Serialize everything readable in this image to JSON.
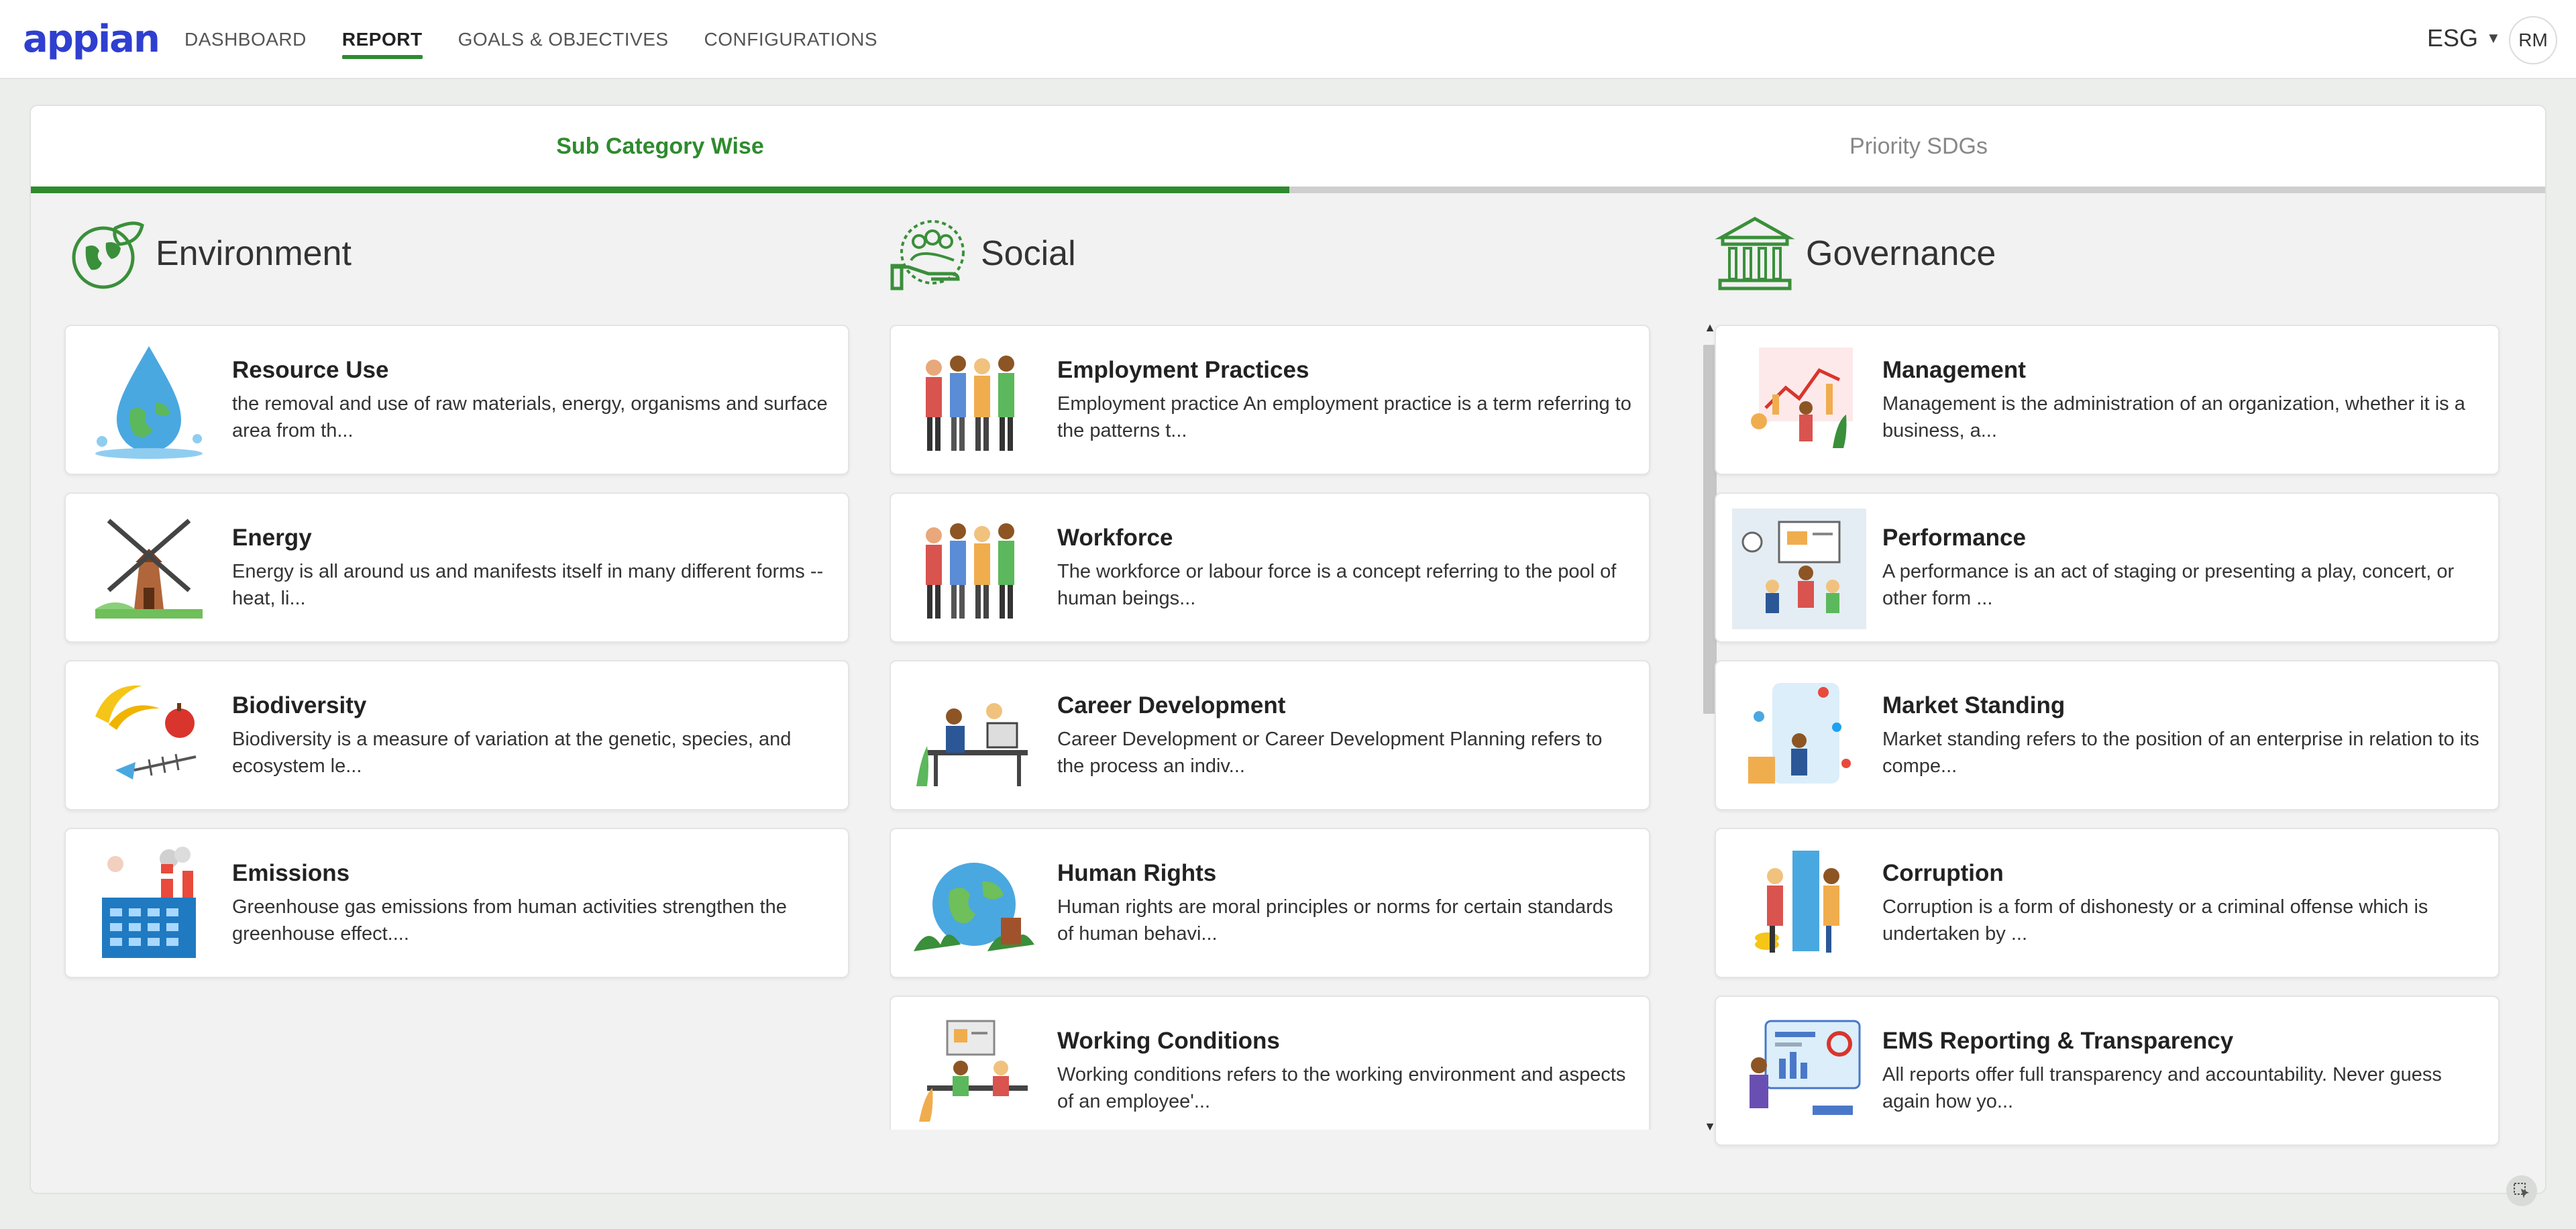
{
  "app": {
    "logo": "appian"
  },
  "nav": {
    "items": [
      {
        "label": "DASHBOARD",
        "active": false
      },
      {
        "label": "REPORT",
        "active": true
      },
      {
        "label": "GOALS & OBJECTIVES",
        "active": false
      },
      {
        "label": "CONFIGURATIONS",
        "active": false
      }
    ],
    "esg_menu": "ESG",
    "avatar_initials": "RM"
  },
  "tabs": [
    {
      "label": "Sub Category Wise",
      "active": true
    },
    {
      "label": "Priority SDGs",
      "active": false
    }
  ],
  "colors": {
    "accent": "#2e8b2e",
    "logo": "#2f3fcf"
  },
  "columns": {
    "environment": {
      "title": "Environment",
      "icon": "earth-leaf-icon",
      "items": [
        {
          "title": "Resource Use",
          "desc": "the removal and use of raw materials, energy, organisms and surface area from th...",
          "icon": "water-drop-globe-icon"
        },
        {
          "title": "Energy",
          "desc": "Energy is all around us and manifests itself in many different forms -- heat, li...",
          "icon": "windmill-icon"
        },
        {
          "title": "Biodiversity",
          "desc": "Biodiversity is a measure of variation at the genetic, species, and ecosystem le...",
          "icon": "banana-fishbone-icon"
        },
        {
          "title": "Emissions",
          "desc": "Greenhouse gas emissions from human activities strengthen the greenhouse effect....",
          "icon": "factory-icon"
        }
      ]
    },
    "social": {
      "title": "Social",
      "icon": "people-hand-icon",
      "items": [
        {
          "title": "Employment Practices",
          "desc": "Employment practice An employment practice is a term referring to the patterns t...",
          "icon": "group-people-icon"
        },
        {
          "title": "Workforce",
          "desc": "The workforce or labour force is a concept referring to the pool of human beings...",
          "icon": "group-people-icon"
        },
        {
          "title": "Career Development",
          "desc": "Career Development or Career Development Planning refers to the process an indiv...",
          "icon": "desk-workers-icon"
        },
        {
          "title": "Human Rights",
          "desc": "Human rights are moral principles or norms for certain standards of human behavi...",
          "icon": "globe-hands-icon"
        },
        {
          "title": "Working Conditions",
          "desc": "Working conditions refers to the working environment and aspects of an employee'...",
          "icon": "office-meeting-icon"
        }
      ]
    },
    "governance": {
      "title": "Governance",
      "icon": "government-building-icon",
      "items": [
        {
          "title": "Management",
          "desc": "Management is the administration of an organization, whether it is a business, a...",
          "icon": "growth-chart-icon"
        },
        {
          "title": "Performance",
          "desc": "A performance is an act of staging or presenting a play, concert, or other form ...",
          "icon": "presentation-icon"
        },
        {
          "title": "Market Standing",
          "desc": "Market standing refers to the position of an enterprise in relation to its compe...",
          "icon": "social-media-icon"
        },
        {
          "title": "Corruption",
          "desc": "Corruption is a form of dishonesty or a criminal offense which is undertaken by ...",
          "icon": "bribe-icon"
        },
        {
          "title": "EMS Reporting & Transparency",
          "desc": "All reports offer full transparency and accountability. Never guess again how yo...",
          "icon": "report-dashboard-icon"
        }
      ]
    }
  }
}
